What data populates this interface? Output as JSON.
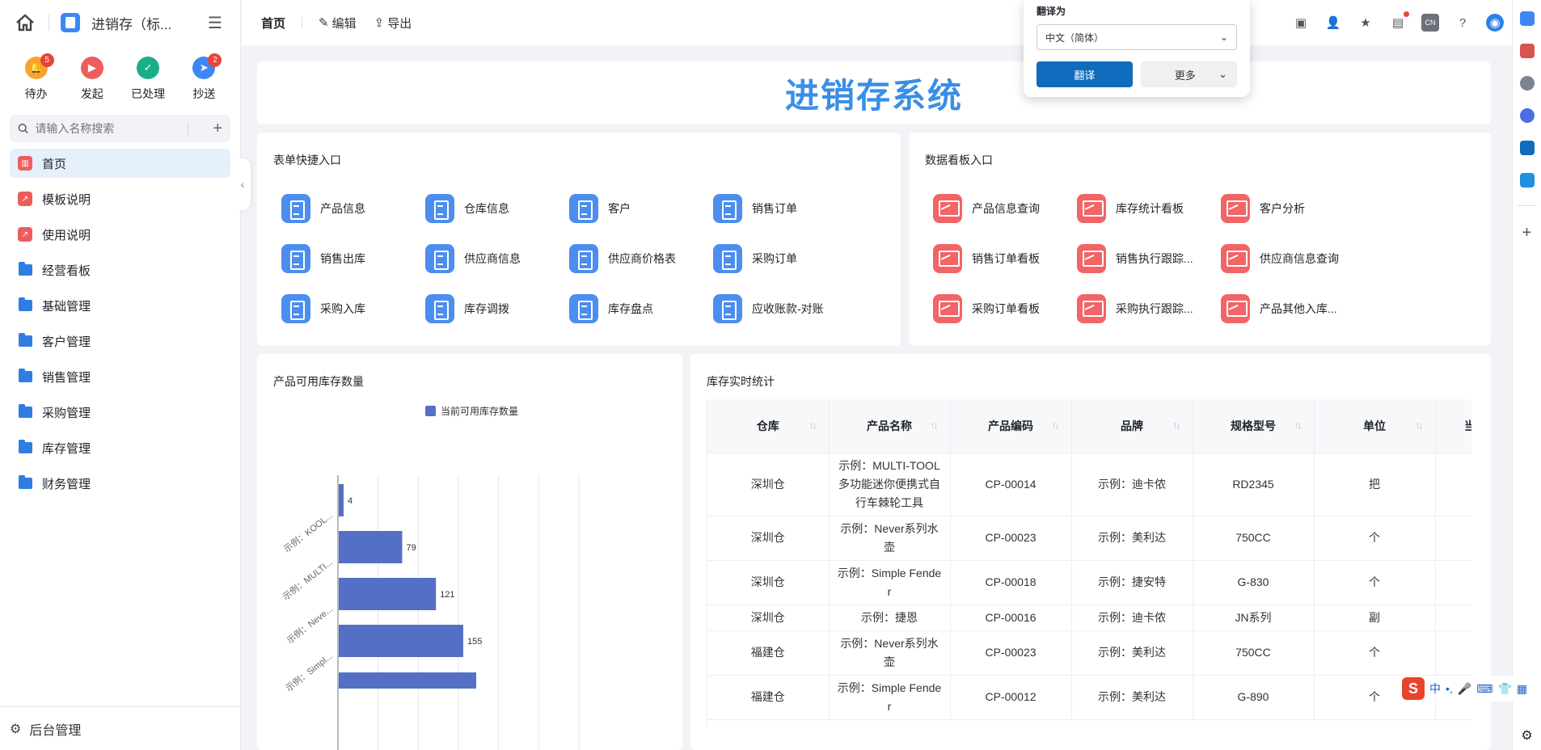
{
  "app": {
    "title": "进销存（标..."
  },
  "quick_actions": [
    {
      "label": "待办",
      "badge": "5",
      "color": "#f7a32b"
    },
    {
      "label": "发起",
      "badge": "",
      "color": "#ee5d5d"
    },
    {
      "label": "已处理",
      "badge": "",
      "color": "#1aae88"
    },
    {
      "label": "抄送",
      "badge": "2",
      "color": "#3d87f5"
    }
  ],
  "search": {
    "placeholder": "请输入名称搜索"
  },
  "nav": [
    {
      "label": "首页",
      "icon": "bank-icon",
      "active": true
    },
    {
      "label": "模板说明",
      "icon": "dashboard-icon"
    },
    {
      "label": "使用说明",
      "icon": "dashboard-icon"
    },
    {
      "label": "经营看板",
      "icon": "folder-icon"
    },
    {
      "label": "基础管理",
      "icon": "folder-icon"
    },
    {
      "label": "客户管理",
      "icon": "folder-icon"
    },
    {
      "label": "销售管理",
      "icon": "folder-icon"
    },
    {
      "label": "采购管理",
      "icon": "folder-icon"
    },
    {
      "label": "库存管理",
      "icon": "folder-icon"
    },
    {
      "label": "财务管理",
      "icon": "folder-icon"
    }
  ],
  "bottom": {
    "label": "后台管理"
  },
  "topbar": {
    "home": "首页",
    "edit": "编辑",
    "export": "导出",
    "lang_badge": "CN"
  },
  "hero": {
    "title": "进销存系统"
  },
  "forms_card": {
    "title": "表单快捷入口",
    "items": [
      "产品信息",
      "仓库信息",
      "客户",
      "销售订单",
      "销售出库",
      "供应商信息",
      "供应商价格表",
      "采购订单",
      "采购入库",
      "库存调拨",
      "库存盘点",
      "应收账款-对账"
    ]
  },
  "dash_card": {
    "title": "数据看板入口",
    "items": [
      "产品信息查询",
      "库存统计看板",
      "客户分析",
      "销售订单看板",
      "销售执行跟踪...",
      "供应商信息查询",
      "采购订单看板",
      "采购执行跟踪...",
      "产品其他入库..."
    ]
  },
  "chart_card": {
    "title": "产品可用库存数量"
  },
  "chart_data": {
    "type": "bar",
    "orientation": "horizontal",
    "legend": "当前可用库存数量",
    "legend_position": "top-center",
    "color": "#5470c6",
    "categories": [
      "示例：KOOL...",
      "示例：MULTI...",
      "示例：Neve...",
      "示例：Simpl..."
    ],
    "values": [
      4,
      79,
      121,
      155
    ],
    "xlim": [
      0,
      200
    ],
    "grid": true
  },
  "table_card": {
    "title": "库存实时统计",
    "columns": [
      "仓库",
      "产品名称",
      "产品编码",
      "品牌",
      "规格型号",
      "单位",
      "当前"
    ],
    "rows": [
      [
        "深圳仓",
        "示例：MULTI-TOOL多功能迷你便携式自行车棘轮工具",
        "CP-00014",
        "示例：迪卡侬",
        "RD2345",
        "把",
        ""
      ],
      [
        "深圳仓",
        "示例：Never系列水壶",
        "CP-00023",
        "示例：美利达",
        "750CC",
        "个",
        ""
      ],
      [
        "深圳仓",
        "示例：Simple Fender",
        "CP-00018",
        "示例：捷安特",
        "G-830",
        "个",
        ""
      ],
      [
        "深圳仓",
        "示例：捷恩",
        "CP-00016",
        "示例：迪卡侬",
        "JN系列",
        "副",
        ""
      ],
      [
        "福建仓",
        "示例：Never系列水壶",
        "CP-00023",
        "示例：美利达",
        "750CC",
        "个",
        ""
      ],
      [
        "福建仓",
        "示例：Simple Fender",
        "CP-00012",
        "示例：美利达",
        "G-890",
        "个",
        ""
      ]
    ]
  },
  "translate": {
    "title": "翻译为",
    "language": "中文（简体）",
    "primary": "翻译",
    "more": "更多"
  },
  "ime": {
    "label": "中"
  }
}
